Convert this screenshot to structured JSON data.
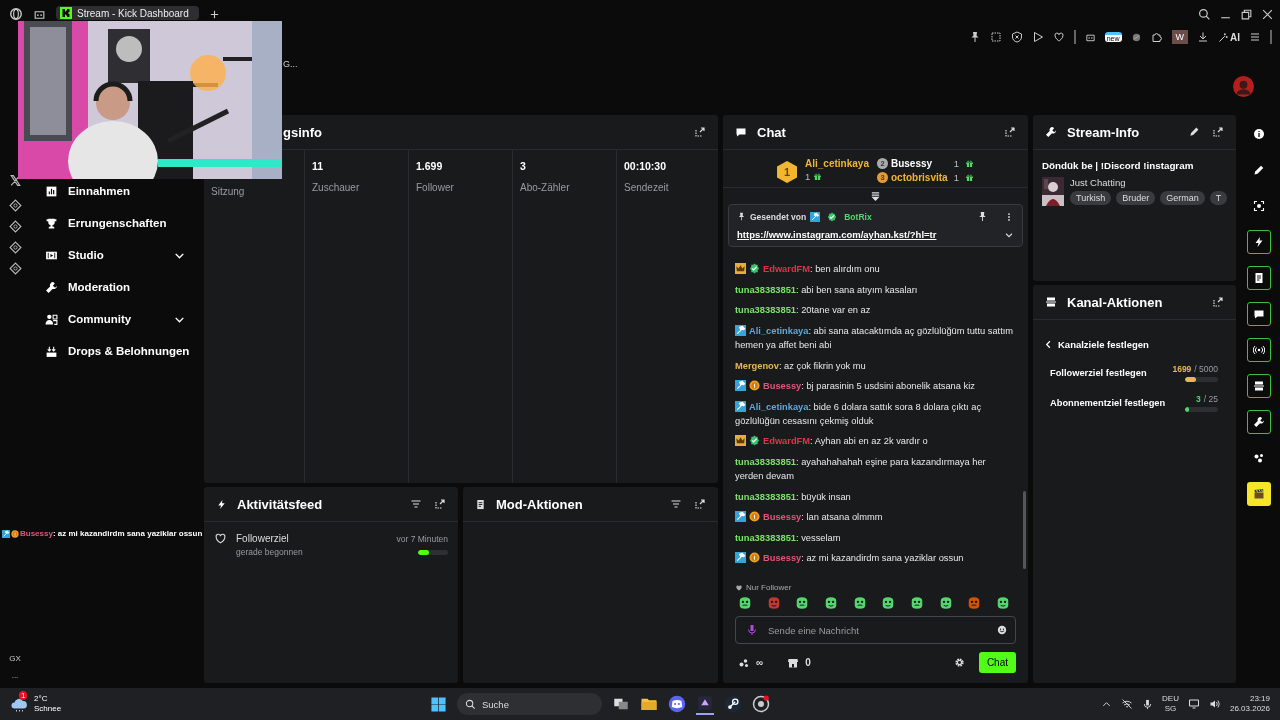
{
  "browser": {
    "tab_title": "Stream - Kick Dashboard",
    "toolbar_badge": "new",
    "profile_letter": "W",
    "ai_label": "AI",
    "rail_labels": [
      "GX",
      "..."
    ]
  },
  "header": {
    "title_fragment": "G..."
  },
  "nav": [
    {
      "label": "Einnahmen",
      "kind": "link"
    },
    {
      "label": "Errungenschaften",
      "kind": "link"
    },
    {
      "label": "Studio",
      "kind": "group",
      "expanded": false
    },
    {
      "label": "Moderation",
      "kind": "link"
    },
    {
      "label": "Community",
      "kind": "group",
      "expanded": false
    },
    {
      "label": "Drops & Belohnungen",
      "kind": "link"
    }
  ],
  "overlay_chat": {
    "user": "Busessy",
    "color": "#e0567a",
    "text": " : az mi kazandirdm sana yaziklar ossun",
    "badges": [
      {
        "kind": "mod"
      },
      {
        "kind": "sub"
      }
    ]
  },
  "stats_panel": {
    "title": "gsinfo",
    "stats": [
      {
        "label": "Sitzung"
      },
      {
        "value": "11",
        "label": "Zuschauer"
      },
      {
        "value": "1.699",
        "label": "Follower"
      },
      {
        "value": "3",
        "label": "Abo-Zähler"
      },
      {
        "value": "00:10:30",
        "label": "Sendezeit"
      }
    ]
  },
  "activity_panel": {
    "title": "Aktivitätsfeed",
    "items": [
      {
        "title": "Followerziel",
        "subtitle": "gerade begonnen",
        "time": "vor 7 Minuten",
        "level": 0.35
      }
    ]
  },
  "mod_panel": {
    "title": "Mod-Aktionen"
  },
  "chat": {
    "title": "Chat",
    "gifters": [
      {
        "rank": "1",
        "name": "Ali_cetinkaya",
        "count": "1",
        "color": "#f2b630"
      },
      {
        "rank": "2",
        "name": "Busessy",
        "count": "1",
        "color": "#ffffff"
      },
      {
        "rank": "3",
        "name": "octobrisvita",
        "count": "1",
        "color": "#f2b630"
      }
    ],
    "pinned": {
      "label": "Gesendet von",
      "sender": "BotRix",
      "link": "https://www.instagram.com/ayhan.kst/?hl=tr"
    },
    "messages": [
      {
        "user": "EdwardFM",
        "color": "#e0334a",
        "badges": [
          {
            "kind": "crown"
          },
          {
            "kind": "verified"
          }
        ],
        "text": ": ben alırdım onu"
      },
      {
        "user": "tuna38383851",
        "color": "#7be36a",
        "text": ": abi ben sana atıyım kasaları"
      },
      {
        "user": "tuna38383851",
        "color": "#7be36a",
        "text": ": 20tane var en az"
      },
      {
        "user": "Ali_cetinkaya",
        "color": "#5ea8d9",
        "badges": [
          {
            "kind": "mod"
          }
        ],
        "text": ": abi sana atacaktımda aç gözlülüğüm tuttu sattım hemen ya affet beni abi"
      },
      {
        "user": "Mergenov",
        "color": "#e8b84a",
        "text": ": az çok fikrin yok mu"
      },
      {
        "user": "Busessy",
        "color": "#e0567a",
        "badges": [
          {
            "kind": "mod"
          },
          {
            "kind": "sub"
          }
        ],
        "text": ": bj parasinin 5 usdsini abonelik atsana kiz"
      },
      {
        "user": "Ali_cetinkaya",
        "color": "#5ea8d9",
        "badges": [
          {
            "kind": "mod"
          }
        ],
        "text": ": bide 6 dolara sattık sora 8 dolara çıktı aç gözlülüğün cesasını çekmiş olduk"
      },
      {
        "user": "EdwardFM",
        "color": "#e0334a",
        "badges": [
          {
            "kind": "crown"
          },
          {
            "kind": "verified"
          }
        ],
        "text": ": Ayhan abi en az 2k vardır o"
      },
      {
        "user": "tuna38383851",
        "color": "#7be36a",
        "text": ": ayahahahahah eşine para kazandırmaya her yerden devam"
      },
      {
        "user": "tuna38383851",
        "color": "#7be36a",
        "text": ": büyük insan"
      },
      {
        "user": "Busessy",
        "color": "#e0567a",
        "badges": [
          {
            "kind": "mod"
          },
          {
            "kind": "sub"
          }
        ],
        "text": ": lan atsana olmmm"
      },
      {
        "user": "tuna38383851",
        "color": "#7be36a",
        "text": ": vesselam"
      },
      {
        "user": "Busessy",
        "color": "#e0567a",
        "badges": [
          {
            "kind": "mod"
          },
          {
            "kind": "sub"
          }
        ],
        "text": ": az mi kazandirdm sana yaziklar ossun"
      }
    ],
    "mode_label": "Nur Follower",
    "input": {
      "placeholder": "Sende eine Nachricht"
    },
    "points": "∞",
    "store_count": "0",
    "send_label": "Chat"
  },
  "stream_info": {
    "title": "Stream-Info",
    "stream_title": "Döndük be | !Discord !instagram",
    "category": "Just Chatting",
    "tags": [
      "Turkish",
      "Bruder",
      "German",
      "T"
    ]
  },
  "channel_actions": {
    "title": "Kanal-Aktionen",
    "back_label": "Kanalziele festlegen",
    "goals": [
      {
        "label": "Followerziel festlegen",
        "current": "1699",
        "target": "/ 5000",
        "level": 0.34
      },
      {
        "label": "Abonnementziel festlegen",
        "current": "3",
        "target": "/ 25",
        "level": 0.12
      }
    ]
  },
  "quick_actions": [
    {
      "kind": "plain"
    },
    {
      "kind": "plain"
    },
    {
      "kind": "plain"
    },
    {
      "kind": "outlined"
    },
    {
      "kind": "outlined"
    },
    {
      "kind": "outlined"
    },
    {
      "kind": "outlined"
    },
    {
      "kind": "outlined"
    },
    {
      "kind": "outlined"
    },
    {
      "kind": "plain"
    },
    {
      "kind": "accent"
    }
  ],
  "taskbar": {
    "weather_badge": "1",
    "temperature": "2°C",
    "weather": "Schnee",
    "search_placeholder": "Suche",
    "language": "DEU",
    "layout": "SG",
    "time": "23:19",
    "date": "26.03.2026"
  }
}
